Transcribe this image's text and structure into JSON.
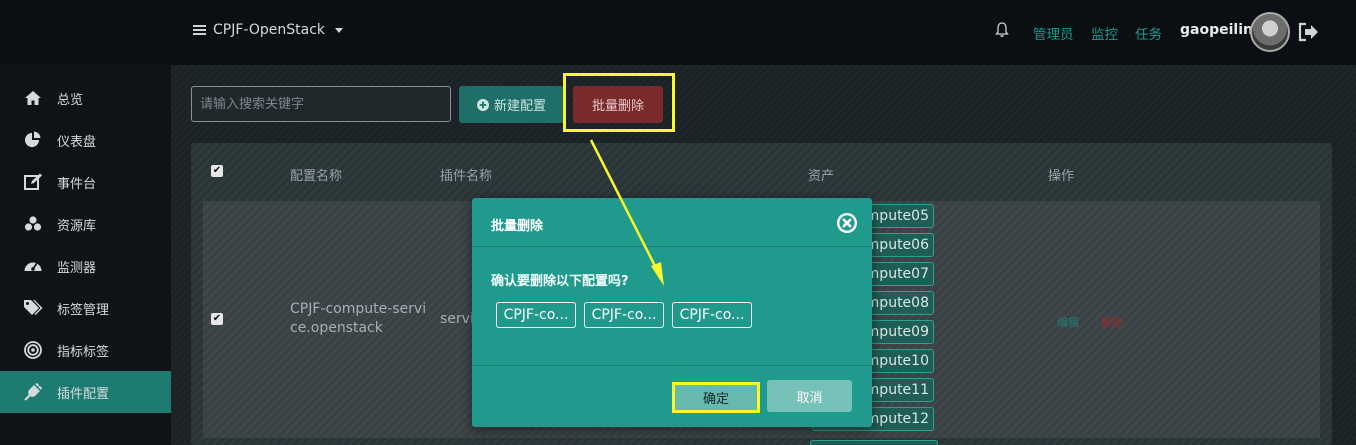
{
  "header": {
    "project": "CPJF-OpenStack",
    "links": [
      "管理员",
      "监控",
      "任务"
    ],
    "user": "gaopeilin"
  },
  "sidebar": {
    "items": [
      {
        "label": "总览",
        "icon": "home-icon"
      },
      {
        "label": "仪表盘",
        "icon": "pie-chart-icon"
      },
      {
        "label": "事件台",
        "icon": "edit-icon"
      },
      {
        "label": "资源库",
        "icon": "cubes-icon"
      },
      {
        "label": "监测器",
        "icon": "dashboard-icon"
      },
      {
        "label": "标签管理",
        "icon": "tags-icon"
      },
      {
        "label": "指标标签",
        "icon": "target-icon"
      },
      {
        "label": "插件配置",
        "icon": "plug-icon",
        "active": true
      }
    ]
  },
  "toolbar": {
    "search_placeholder": "请输入搜索关键字",
    "new_label": "新建配置",
    "batch_delete_label": "批量删除"
  },
  "table": {
    "headers": [
      "配置名称",
      "插件名称",
      "资产",
      "操作"
    ],
    "row": {
      "name": "CPJF-compute-service.openstack",
      "plugin": "servi",
      "assets": [
        "mpute05",
        "mpute06",
        "mpute07",
        "mpute08",
        "mpute09",
        "mpute10",
        "mpute11",
        "mpute12"
      ],
      "edit": "编辑",
      "delete": "删除"
    }
  },
  "modal": {
    "title": "批量删除",
    "question": "确认要删除以下配置吗?",
    "items": [
      "CPJF-co...",
      "CPJF-co...",
      "CPJF-co..."
    ],
    "confirm": "确定",
    "cancel": "取消"
  },
  "colors": {
    "accent": "#1f9a8c",
    "danger": "#7a2a2a",
    "highlight": "#f7f72a"
  }
}
